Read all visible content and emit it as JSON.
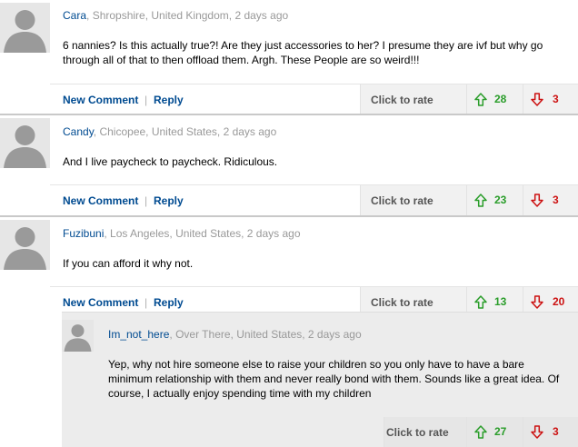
{
  "ui": {
    "new_comment": "New Comment",
    "reply": "Reply",
    "pipe": "|",
    "click_to_rate": "Click to rate",
    "up_icon": "arrow-up-icon",
    "down_icon": "arrow-down-icon",
    "avatar_icon": "default-avatar-silhouette"
  },
  "colors": {
    "name": "#004b91",
    "meta": "#999999",
    "link": "#004b91",
    "upvote": "#2a9d2a",
    "downvote": "#cc1111"
  },
  "comments": [
    {
      "name": "Cara",
      "location": "Shropshire, United Kingdom",
      "time": "2 days ago",
      "text": "6 nannies? Is this actually true?! Are they just accessories to her? I presume they are ivf but why go through all of that to then offload them. Argh. These People are so weird!!!",
      "up": "28",
      "down": "3"
    },
    {
      "name": "Candy",
      "location": "Chicopee, United States",
      "time": "2 days ago",
      "text": "And I live paycheck to paycheck. Ridiculous.",
      "up": "23",
      "down": "3"
    },
    {
      "name": "Fuzibuni",
      "location": "Los Angeles, United States",
      "time": "2 days ago",
      "text": "If you can afford it why not.",
      "up": "13",
      "down": "20"
    }
  ],
  "reply": {
    "name": "Im_not_here",
    "location": "Over There, United States",
    "time": "2 days ago",
    "text": "Yep, why not hire someone else to raise your children so you only have to have a bare minimum relationship with them and never really bond with them. Sounds like a great idea. Of course, I actually enjoy spending time with my children",
    "up": "27",
    "down": "3"
  }
}
